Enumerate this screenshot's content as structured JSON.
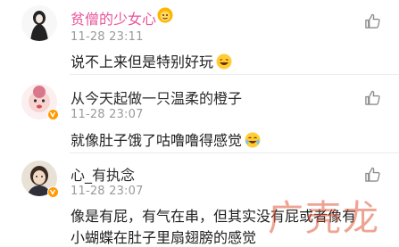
{
  "comments": [
    {
      "username": "贫僧的少女心",
      "timestamp": "11-28 23:11",
      "text": "说不上来但是特别好玩",
      "username_color": "#e8559b"
    },
    {
      "username": "从今天起做一只温柔的橙子",
      "timestamp": "11-28 23:07",
      "text": "就像肚子饿了咕噜噜得感觉",
      "username_color": "#2b2b2b"
    },
    {
      "username": "心_有执念",
      "timestamp": "11-28 23:07",
      "text_lines": [
        "像是有屁，有气在串，但其实没有屁或者像有",
        "小蝴蝶在肚子里扇翅膀的感觉"
      ],
      "username_color": "#2b2b2b"
    }
  ],
  "watermark": "广壳龙"
}
